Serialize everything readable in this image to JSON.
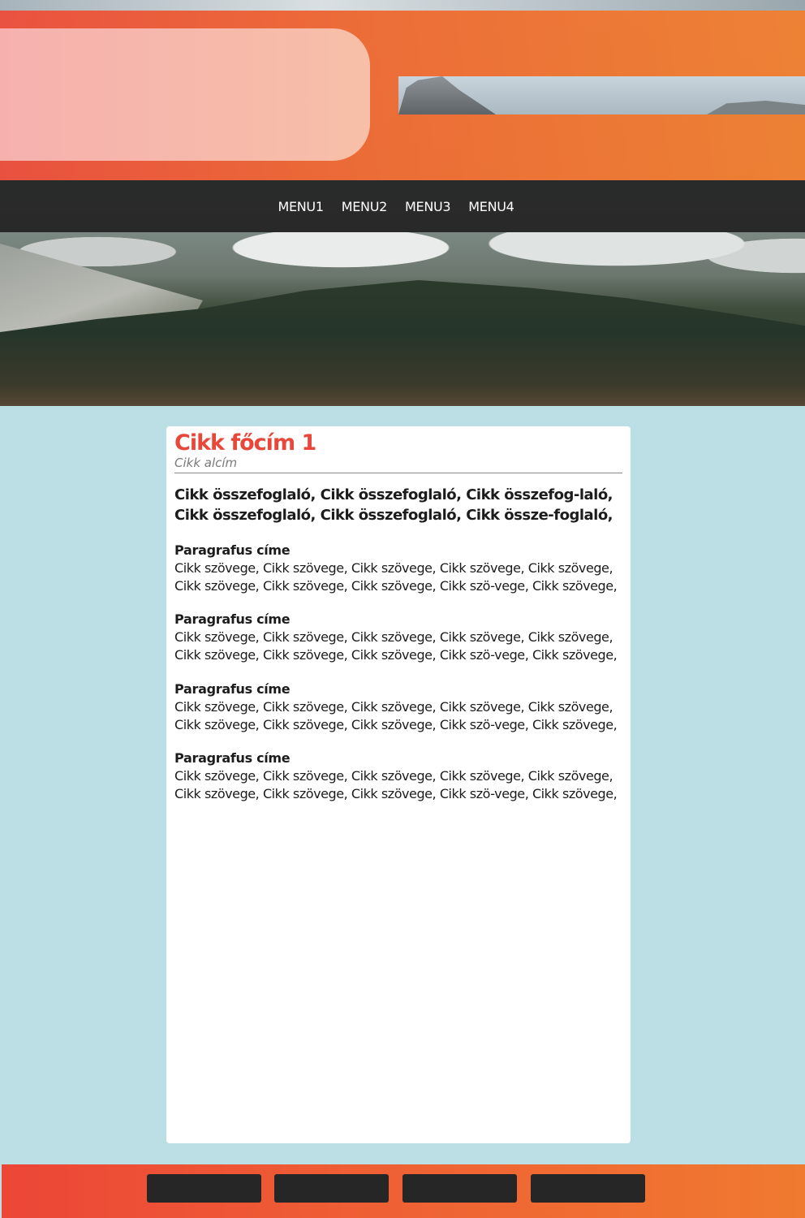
{
  "nav": {
    "items": [
      {
        "label": "MENU1"
      },
      {
        "label": "MENU2"
      },
      {
        "label": "MENU3"
      },
      {
        "label": "MENU4"
      }
    ]
  },
  "article": {
    "title": "Cikk főcím 1",
    "subtitle": "Cikk alcím",
    "summary": "Cikk összefoglaló, Cikk összefoglaló, Cikk összefog-laló, Cikk összefoglaló, Cikk összefoglaló, Cikk össze-foglaló,",
    "paragraphs": [
      {
        "title": "Paragrafus címe",
        "text": "Cikk szövege, Cikk szövege, Cikk szövege, Cikk szövege, Cikk szövege, Cikk szövege, Cikk szövege, Cikk szövege, Cikk szö-vege, Cikk szövege,"
      },
      {
        "title": "Paragrafus címe",
        "text": "Cikk szövege, Cikk szövege, Cikk szövege, Cikk szövege, Cikk szövege, Cikk szövege, Cikk szövege, Cikk szövege, Cikk szö-vege, Cikk szövege,"
      },
      {
        "title": "Paragrafus címe",
        "text": "Cikk szövege, Cikk szövege, Cikk szövege, Cikk szövege, Cikk szövege, Cikk szövege, Cikk szövege, Cikk szövege, Cikk szö-vege, Cikk szövege,"
      },
      {
        "title": "Paragrafus címe",
        "text": "Cikk szövege, Cikk szövege, Cikk szövege, Cikk szövege, Cikk szövege, Cikk szövege, Cikk szövege, Cikk szövege, Cikk szö-vege, Cikk szövege,"
      }
    ]
  },
  "colors": {
    "accent_red": "#e8473a",
    "header_orange": "#f08030",
    "nav_bg": "#262626",
    "page_bg": "#bcdee5"
  }
}
